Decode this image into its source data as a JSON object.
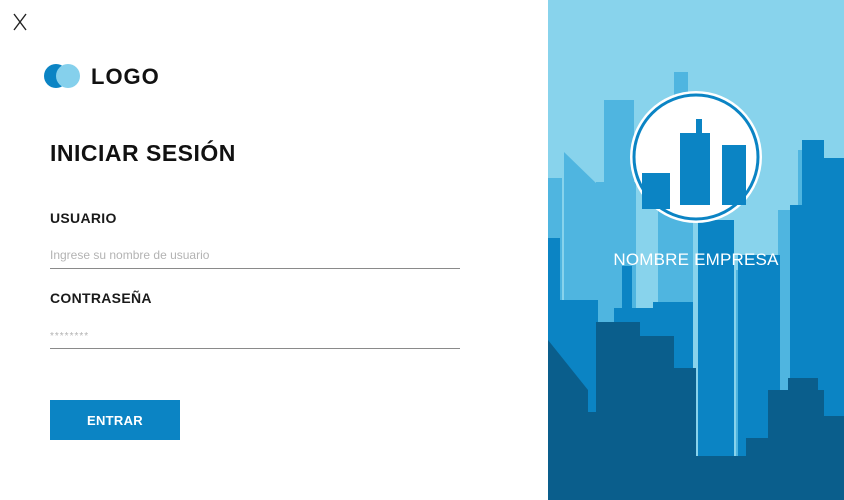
{
  "window": {
    "close_label": "X"
  },
  "brand": {
    "logo_text": "LOGO",
    "colors": {
      "primary": "#0b84c4",
      "light": "#85d0ec"
    }
  },
  "login": {
    "title": "INICIAR SESIÓN",
    "username": {
      "label": "USUARIO",
      "placeholder": "Ingrese su nombre de usuario",
      "value": ""
    },
    "password": {
      "label": "CONTRASEÑA",
      "placeholder": "********",
      "value": ""
    },
    "submit_label": "ENTRAR"
  },
  "hero": {
    "company_name": "NOMBRE EMPRESA",
    "emblem_icon": "city-skyline-icon",
    "background_icon": "city-skyline-illustration",
    "colors": {
      "sky": "#88d3ec",
      "mid": "#4fb5e0",
      "dark": "#0b84c4",
      "darkest": "#0a5e8c"
    }
  }
}
